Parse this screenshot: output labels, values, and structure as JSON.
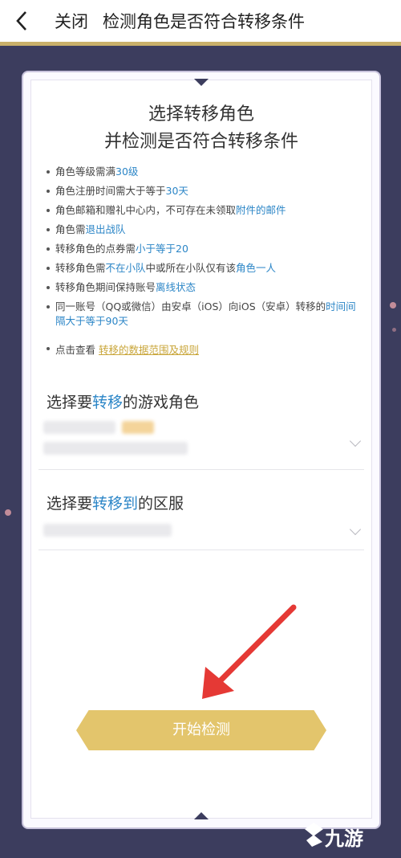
{
  "header": {
    "close_label": "关闭",
    "title": "检测角色是否符合转移条件"
  },
  "card": {
    "headline_line1": "选择转移角色",
    "headline_line2": "并检测是否符合转移条件",
    "rules": [
      {
        "pre": "角色等级需满",
        "hl": "30级",
        "post": ""
      },
      {
        "pre": "角色注册时间需大于等于",
        "hl": "30天",
        "post": ""
      },
      {
        "pre": "角色邮箱和赠礼中心内，不可存在未领取",
        "hl": "附件的邮件",
        "post": ""
      },
      {
        "pre": "角色需",
        "hl": "退出战队",
        "post": ""
      },
      {
        "pre": "转移角色的点券需",
        "hl": "小于等于20",
        "post": ""
      },
      {
        "pre": "转移角色需",
        "hl": "不在小队",
        "post": "中或所在小队仅有该",
        "hl2": "角色一人"
      },
      {
        "pre": "转移角色期间保持账号",
        "hl": "离线状态",
        "post": ""
      },
      {
        "pre": "同一账号（QQ或微信）由安卓（iOS）向iOS（安卓）转移的",
        "hl": "时间间隔大于等于90天",
        "post": ""
      }
    ],
    "view_prefix": "点击查看",
    "view_link": "转移的数据范围及规则",
    "role_section": {
      "pre": "选择要",
      "hl": "转移",
      "post": "的游戏角色"
    },
    "server_section": {
      "pre": "选择要",
      "hl": "转移到",
      "post": "的区服"
    },
    "start_button": "开始检测"
  },
  "watermark": "九游",
  "colors": {
    "background": "#3c3d5e",
    "accent_gold": "#e3c56c",
    "link_blue": "#2c86c7",
    "arrow_red": "#e53935"
  }
}
